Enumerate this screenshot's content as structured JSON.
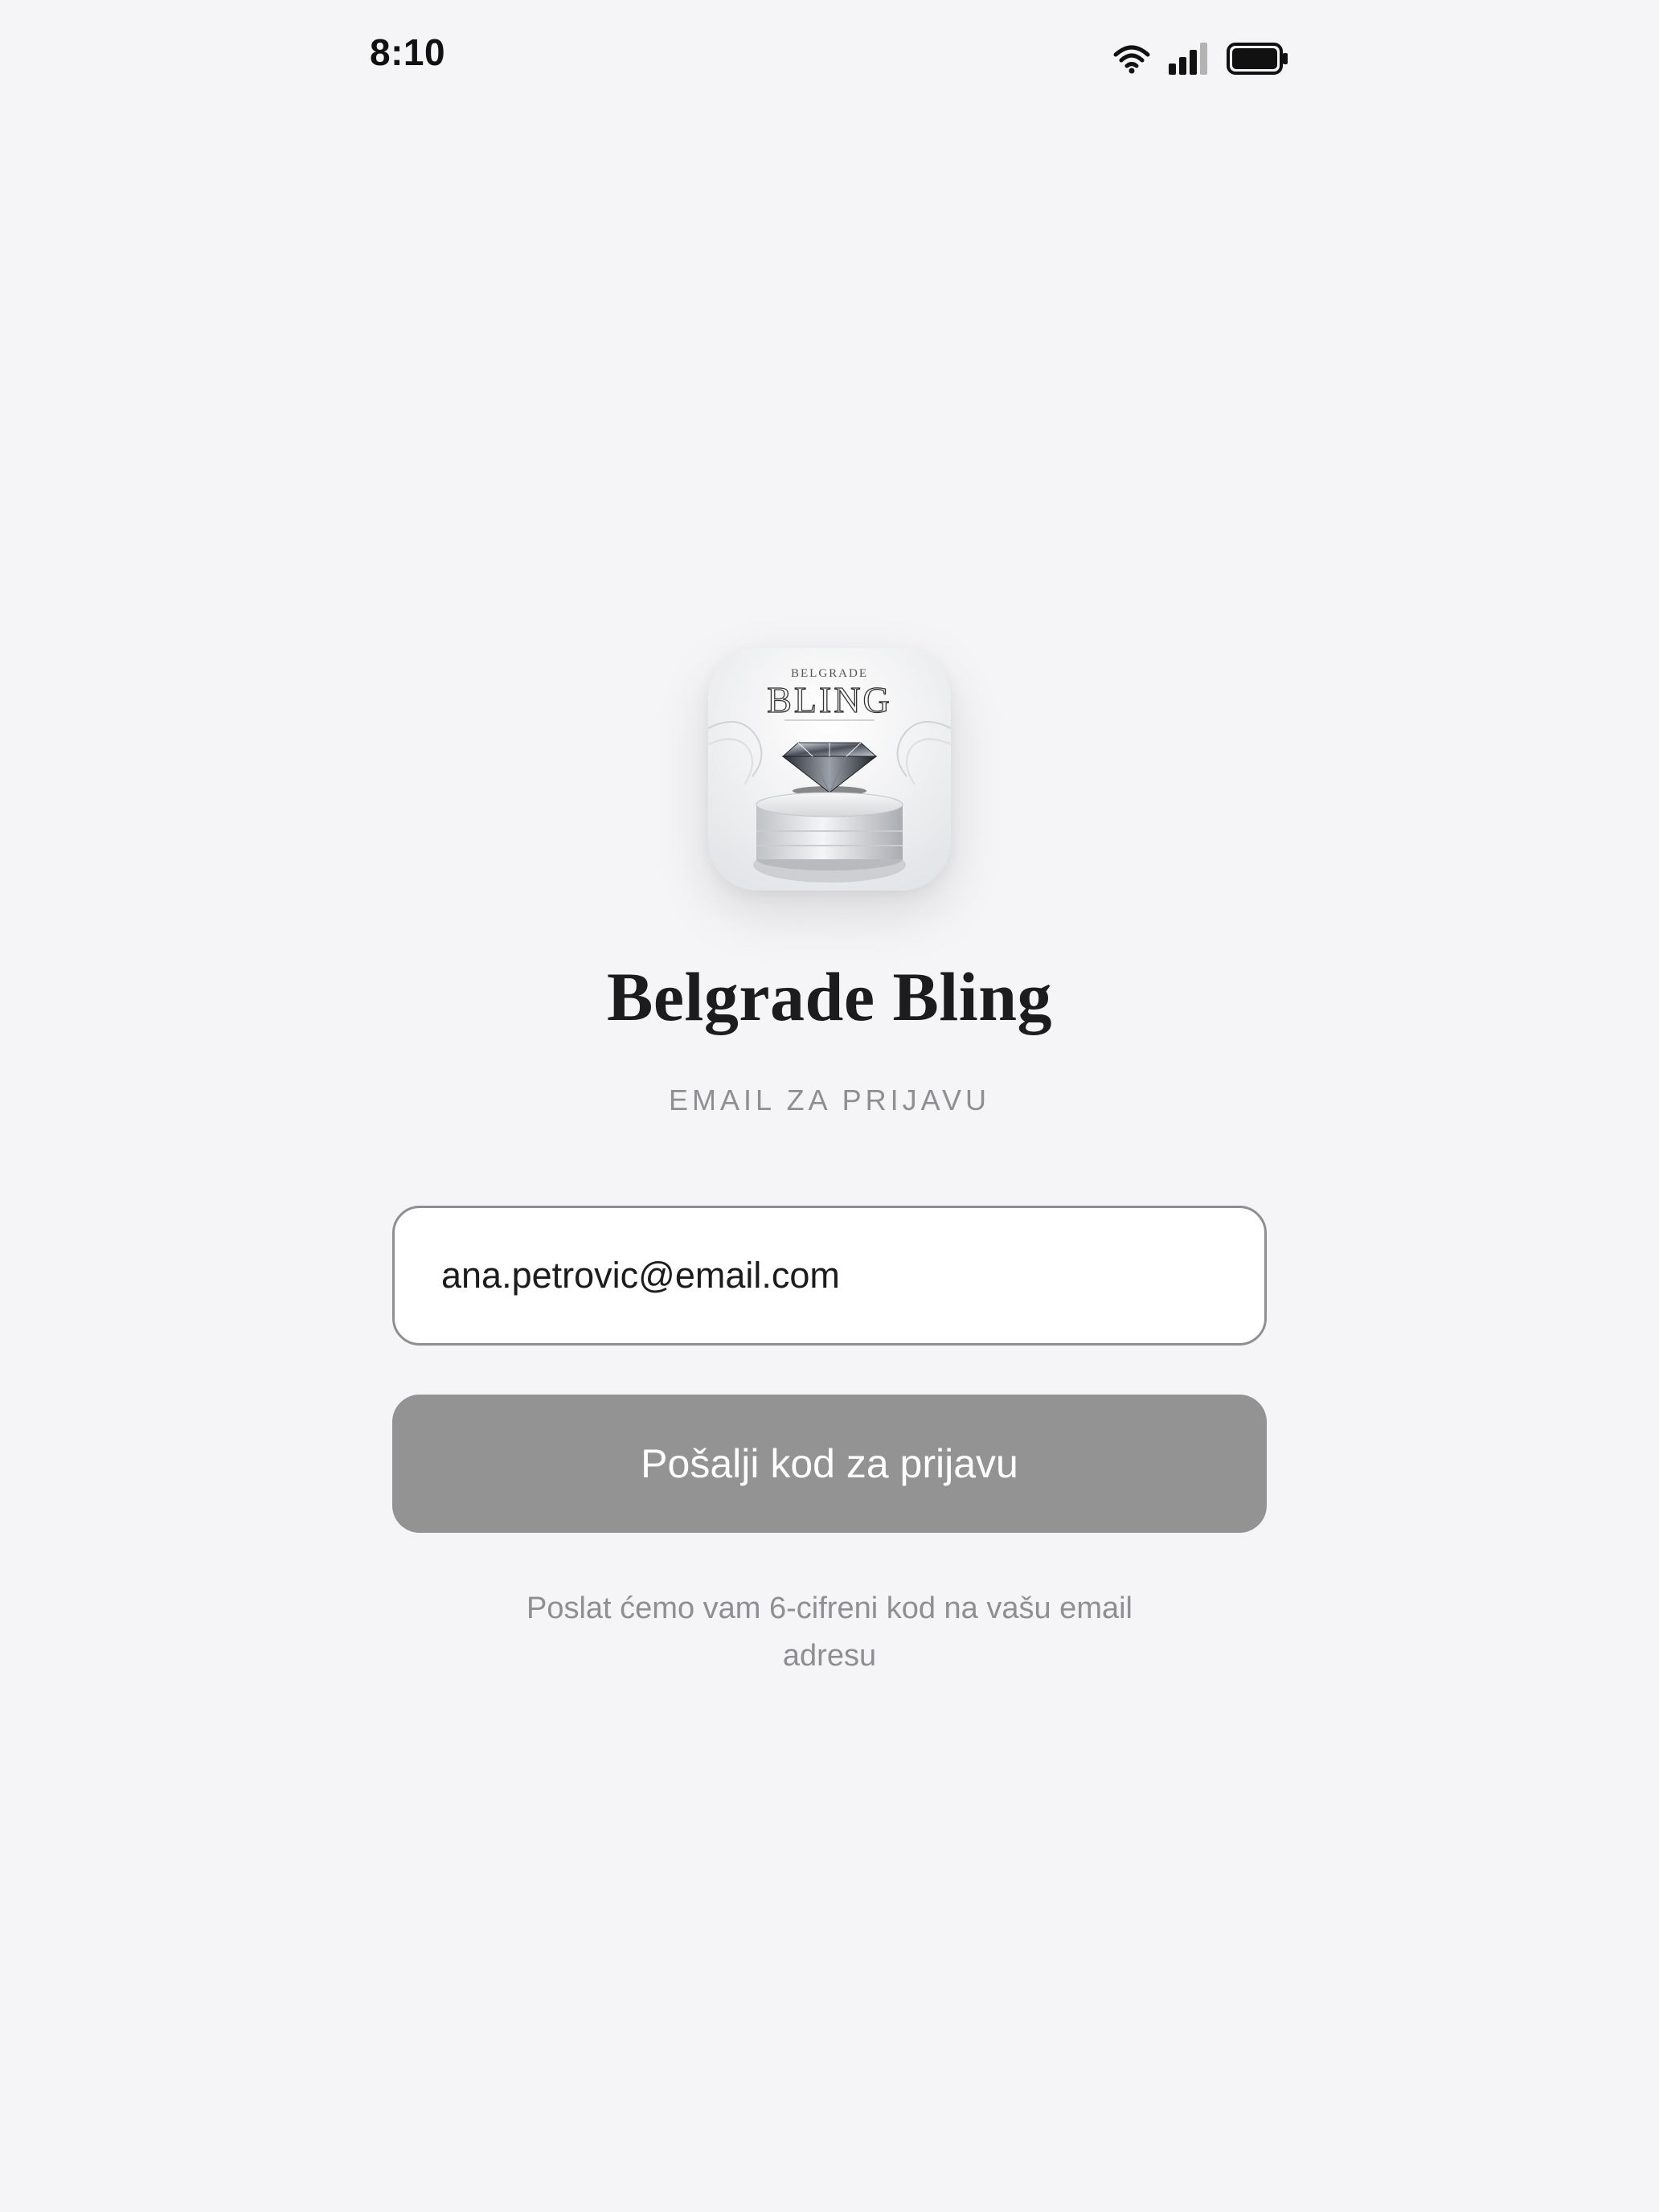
{
  "status_bar": {
    "time": "8:10",
    "icons": [
      "wifi-icon",
      "cellular-signal-icon",
      "battery-icon"
    ]
  },
  "app": {
    "icon": "belgrade-bling-app-icon",
    "icon_text_top": "BELGRADE",
    "icon_text_main": "BLING",
    "title": "Belgrade Bling"
  },
  "login": {
    "email_label": "EMAIL ZA PRIJAVU",
    "email_value": "ana.petrovic@email.com",
    "send_button_label": "Pošalji kod za prijavu",
    "hint": "Poslat ćemo vam 6-cifreni kod na vašu email adresu"
  },
  "colors": {
    "background": "#f5f5f7",
    "button_disabled": "#939393",
    "muted_text": "#8e8e93",
    "title_text": "#1c1c1e"
  }
}
